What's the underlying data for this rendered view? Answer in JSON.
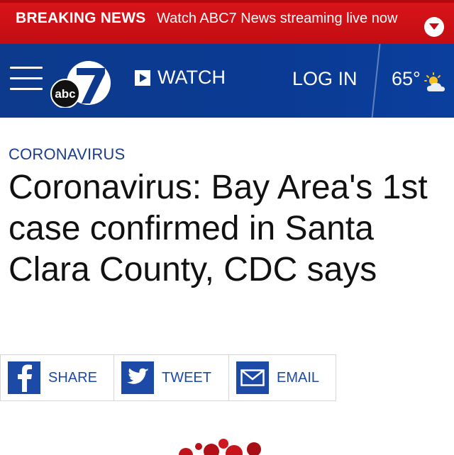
{
  "breaking_bar": {
    "label": "BREAKING NEWS",
    "text": "Watch ABC7 News streaming live now",
    "icon": "chevron-down-icon"
  },
  "header": {
    "logo_text": "abc",
    "logo_number": "7",
    "watch_label": "WATCH",
    "login_label": "LOG IN",
    "temperature": "65°",
    "weather_icon": "partly-sunny-icon"
  },
  "article": {
    "category": "CORONAVIRUS",
    "headline": "Coronavirus: Bay Area's 1st case confirmed in Santa Clara County, CDC says"
  },
  "share": {
    "facebook_label": "SHARE",
    "twitter_label": "TWEET",
    "email_label": "EMAIL"
  },
  "colors": {
    "breaking_red": "#d8141a",
    "header_blue": "#0d3a8c",
    "accent_blue": "#1d4aa6",
    "text": "#111111"
  }
}
